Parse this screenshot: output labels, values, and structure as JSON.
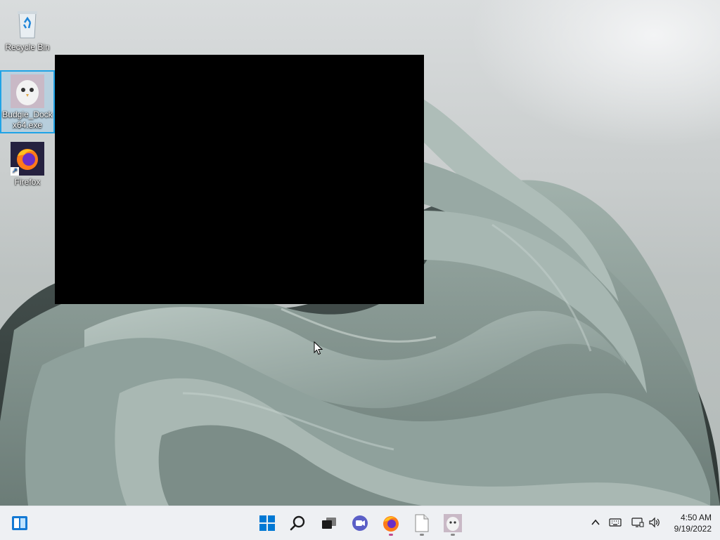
{
  "desktop": {
    "icons": [
      {
        "label": "Recycle Bin",
        "icon": "recycle-bin-icon"
      },
      {
        "label": "Budgie_Dock_x64.exe",
        "label_line1": "Budgie_Dock",
        "label_line2": "x64.exe",
        "icon": "budgie-dock-icon",
        "selected": true
      },
      {
        "label": "Firefox",
        "icon": "firefox-icon",
        "shortcut": true
      }
    ]
  },
  "window": {
    "state": "blank black window"
  },
  "taskbar": {
    "widgets_icon": "widgets-icon",
    "apps": [
      {
        "name": "Start",
        "icon": "windows-start-icon"
      },
      {
        "name": "Search",
        "icon": "search-icon"
      },
      {
        "name": "Task View",
        "icon": "task-view-icon"
      },
      {
        "name": "Chat",
        "icon": "chat-icon"
      },
      {
        "name": "Firefox",
        "icon": "firefox-icon",
        "running": true
      },
      {
        "name": "File",
        "icon": "blank-document-icon",
        "running": true
      },
      {
        "name": "Budgie Dock",
        "icon": "budgie-dock-icon",
        "running": true
      }
    ],
    "tray": {
      "icons": [
        "chevron-up-icon",
        "keyboard-icon",
        "network-icon",
        "volume-icon"
      ]
    },
    "clock": {
      "time": "4:50 AM",
      "date": "9/19/2022"
    }
  },
  "colors": {
    "accent": "#1fa3e6",
    "start": "#0078d4",
    "taskbar_bg": "#eef0f3"
  }
}
